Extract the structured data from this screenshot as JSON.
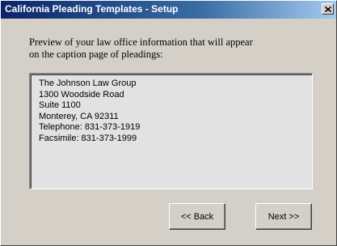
{
  "window": {
    "title": "California Pleading Templates - Setup"
  },
  "intro": {
    "line1": "Preview of your law office information that will appear",
    "line2": "on the caption page of pleadings:"
  },
  "preview": {
    "lines": [
      "The Johnson Law Group",
      "1300 Woodside Road",
      "Suite 1100",
      "Monterey, CA 92311",
      "Telephone: 831-373-1919",
      "Facsimile: 831-373-1999"
    ]
  },
  "buttons": {
    "back_label": "<< Back",
    "next_label": "Next >>"
  }
}
